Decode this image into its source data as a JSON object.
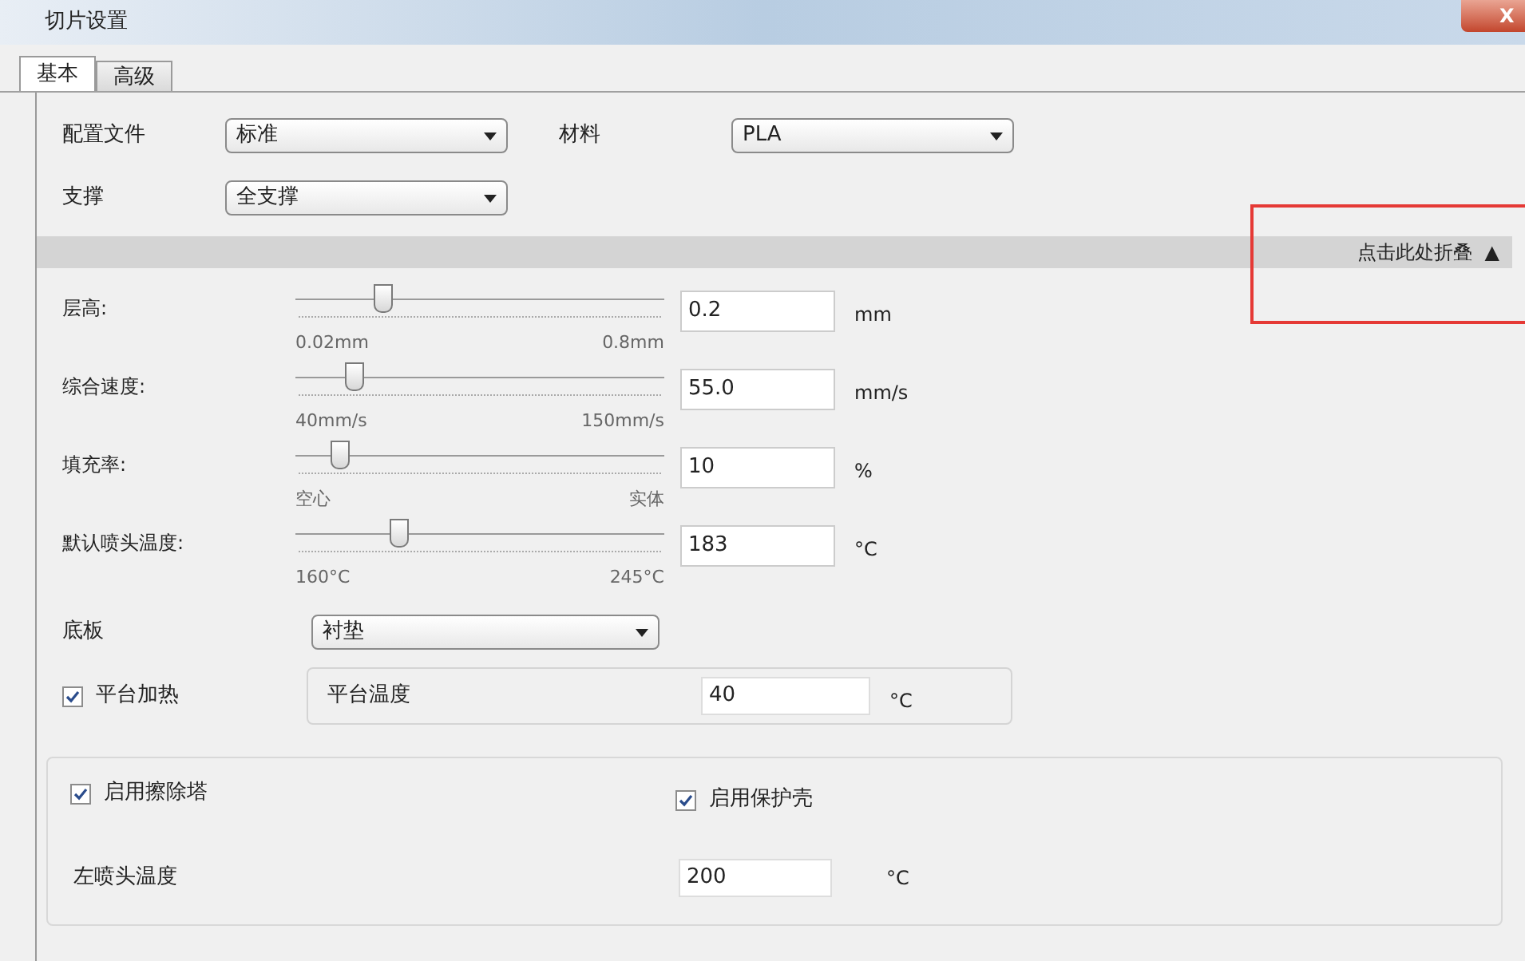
{
  "window": {
    "title": "切片设置",
    "close_label": "X"
  },
  "tabs": [
    {
      "label": "基本",
      "selected": true
    },
    {
      "label": "高级",
      "selected": false
    }
  ],
  "top_fields": [
    {
      "label": "配置文件",
      "value": "标准"
    },
    {
      "label": "材料",
      "value": "PLA"
    },
    {
      "label": "支撑",
      "value": "全支撑"
    }
  ],
  "collapse_bar": {
    "label": "点击此处折叠",
    "arrow": "▲",
    "expanded": true
  },
  "sliders": [
    {
      "label": "层高:",
      "level": 0.24,
      "value": "0.2",
      "unit": "mm",
      "min_label": "0.02mm",
      "max_label": "0.8mm"
    },
    {
      "label": "综合速度:",
      "level": 0.16,
      "value": "55.0",
      "unit": "mm/s",
      "min_label": "40mm/s",
      "max_label": "150mm/s"
    },
    {
      "label": "填充率:",
      "level": 0.12,
      "value": "10",
      "unit": "%",
      "min_label": "空心",
      "max_label": "实体"
    },
    {
      "label": "默认喷头温度:",
      "level": 0.28,
      "value": "183",
      "unit": "°C",
      "min_label": "160°C",
      "max_label": "245°C"
    }
  ],
  "base": {
    "label": "底板",
    "value": "衬垫"
  },
  "bed_heat": {
    "label": "平台加热",
    "checked": true,
    "temp_label": "平台温度",
    "temp_value": "40",
    "unit": "°C"
  },
  "group": {
    "wipe_tower": {
      "label": "启用擦除塔",
      "checked": true
    },
    "ooze_shield": {
      "label": "启用保护壳",
      "checked": true
    },
    "left_nozzle": {
      "label": "左喷头温度",
      "value": "200",
      "unit": "°C"
    }
  }
}
